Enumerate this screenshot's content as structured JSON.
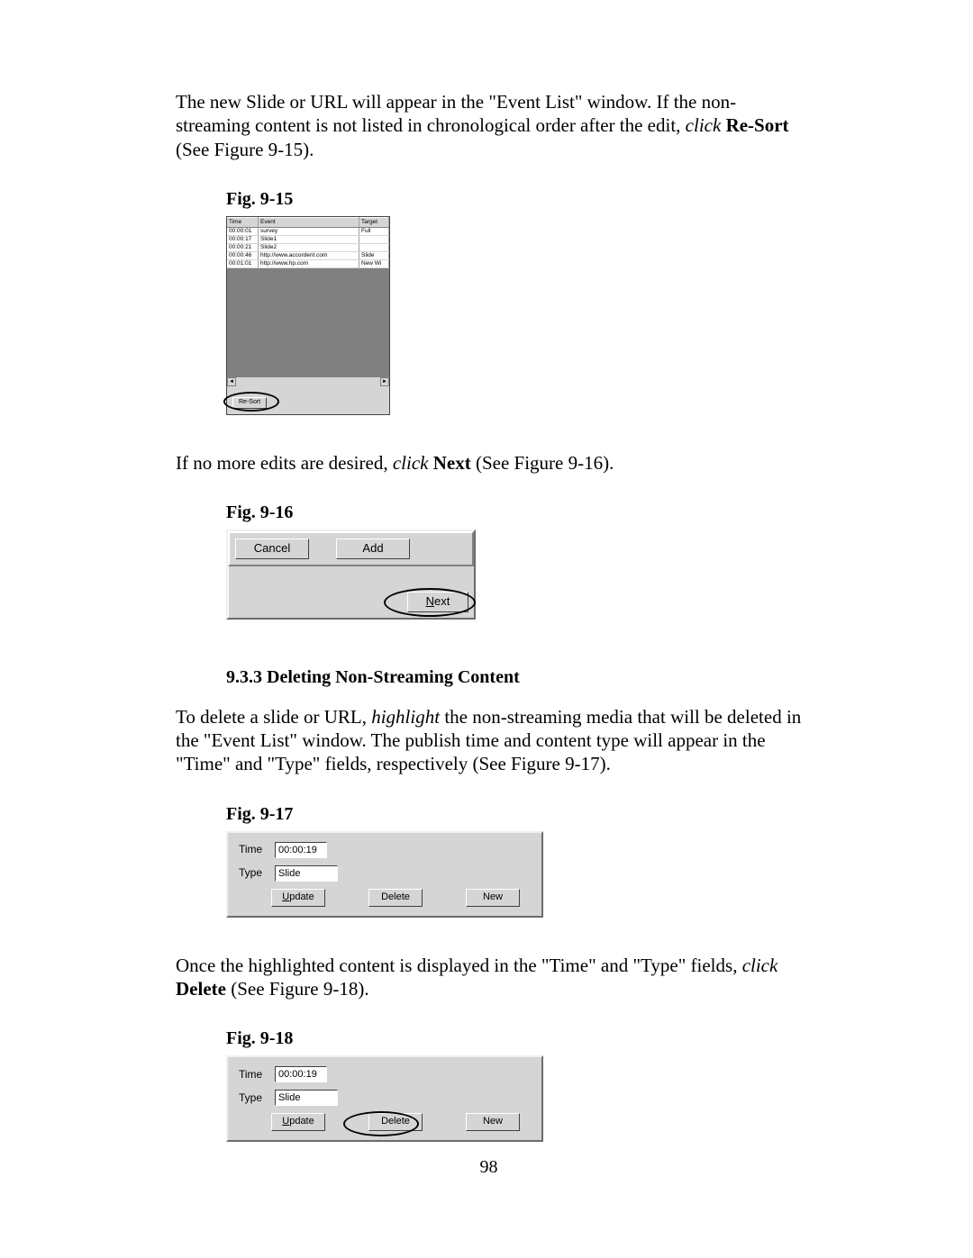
{
  "para1_a": "The new Slide or URL will appear in the \"Event List\" window.  If the non-streaming content is not listed in chronological order after the edit, ",
  "para1_click": "click",
  "para1_resort": " Re-Sort",
  "para1_b": " (See Figure 9-15).",
  "fig915_label": "Fig. 9-15",
  "eventlist": {
    "headers": {
      "time": "Time",
      "event": "Event",
      "target": "Target"
    },
    "rows": [
      {
        "time": "00:00:01",
        "event": "survey",
        "target": "Full"
      },
      {
        "time": "00:00:17",
        "event": "Slide1",
        "target": ""
      },
      {
        "time": "00:00:21",
        "event": "Slide2",
        "target": ""
      },
      {
        "time": "00:00:46",
        "event": "http://www.accordent.com",
        "target": "Slide"
      },
      {
        "time": "00:01:01",
        "event": "http://www.hp.com",
        "target": "New Wi"
      }
    ],
    "resort": "Re-Sort"
  },
  "para2_a": "If no more edits are desired, ",
  "para2_click": "click",
  "para2_next": " Next",
  "para2_b": " (See Figure 9-16).",
  "fig916_label": "Fig. 9-16",
  "fig916": {
    "cancel": "Cancel",
    "add": "Add",
    "next": "Next"
  },
  "section_933": "9.3.3  Deleting Non-Streaming Content",
  "para3_a": "To delete a slide or URL, ",
  "para3_highlight": "highlight",
  "para3_b": " the non-streaming media that will be deleted in the \"Event List\" window.  The publish time and content type will appear in the \"Time\" and \"Type\" fields, respectively (See Figure 9-17).",
  "fig917_label": "Fig. 9-17",
  "fig917": {
    "time_label": "Time",
    "time_value": "00:00:19",
    "type_label": "Type",
    "type_value": "Slide",
    "update": "Update",
    "delete": "Delete",
    "new": "New"
  },
  "para4_a": "Once the highlighted content is displayed in the \"Time\" and \"Type\" fields, ",
  "para4_click": "click",
  "para4_delete": " Delete",
  "para4_b": " (See Figure 9-18).",
  "fig918_label": "Fig. 9-18",
  "page_number": "98"
}
